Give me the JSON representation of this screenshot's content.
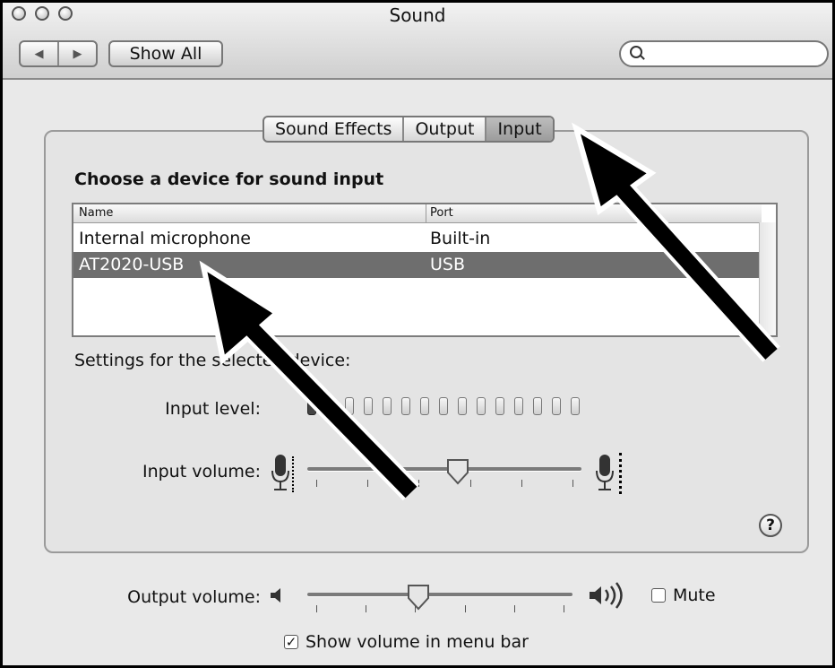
{
  "window": {
    "title": "Sound"
  },
  "toolbar": {
    "back_icon": "back-arrow-icon",
    "forward_icon": "forward-arrow-icon",
    "show_all_label": "Show All",
    "search_placeholder": ""
  },
  "tabs": [
    {
      "label": "Sound Effects",
      "selected": false
    },
    {
      "label": "Output",
      "selected": false
    },
    {
      "label": "Input",
      "selected": true
    }
  ],
  "input": {
    "heading": "Choose a device for sound input",
    "columns": [
      "Name",
      "Port"
    ],
    "devices": [
      {
        "name": "Internal microphone",
        "port": "Built-in",
        "selected": false
      },
      {
        "name": "AT2020-USB",
        "port": "USB",
        "selected": true
      }
    ],
    "settings_label": "Settings for the selected device:",
    "input_level_label": "Input level:",
    "input_level": {
      "lit": 2,
      "total": 15
    },
    "input_volume_label": "Input volume:",
    "input_volume": 0.55
  },
  "output": {
    "volume_label": "Output volume:",
    "volume": 0.42,
    "mute_label": "Mute",
    "mute_checked": false,
    "show_volume_label": "Show volume in menu bar",
    "show_volume_checked": true
  },
  "help": {
    "label": "?"
  },
  "colors": {
    "selection": "#6e6e6e",
    "background": "#e9e9e9"
  }
}
